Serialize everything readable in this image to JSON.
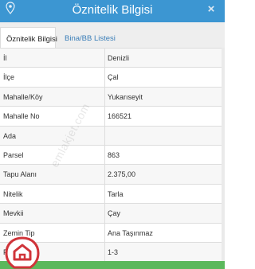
{
  "window": {
    "title": "Öznitelik Bilgisi",
    "close_glyph": "×"
  },
  "tabs": [
    {
      "label": "Öznitelik Bilgisi",
      "active": true
    },
    {
      "label": "Bina/BB Listesi",
      "active": false
    }
  ],
  "attributes": [
    {
      "key": "İl",
      "value": "Denizli"
    },
    {
      "key": "İlçe",
      "value": "Çal"
    },
    {
      "key": "Mahalle/Köy",
      "value": "Yukarıseyit"
    },
    {
      "key": "Mahalle No",
      "value": "166521"
    },
    {
      "key": "Ada",
      "value": ""
    },
    {
      "key": "Parsel",
      "value": "863"
    },
    {
      "key": "Tapu Alanı",
      "value": "2.375,00"
    },
    {
      "key": "Nitelik",
      "value": "Tarla"
    },
    {
      "key": "Mevkii",
      "value": "Çay"
    },
    {
      "key": "Zemin Tip",
      "value": "Ana Taşınmaz"
    },
    {
      "key": "Pafta",
      "value": "1-3"
    }
  ],
  "watermark": {
    "text": "emlakjet.com"
  },
  "colors": {
    "header_bg": "#3c96d2",
    "tab_link": "#3c7fb8",
    "footer_bar": "#5cb85c",
    "logo_red": "#d0343a"
  },
  "icons": {
    "pin": "map-pin-icon",
    "close": "close-icon",
    "logo": "brand-logo"
  }
}
